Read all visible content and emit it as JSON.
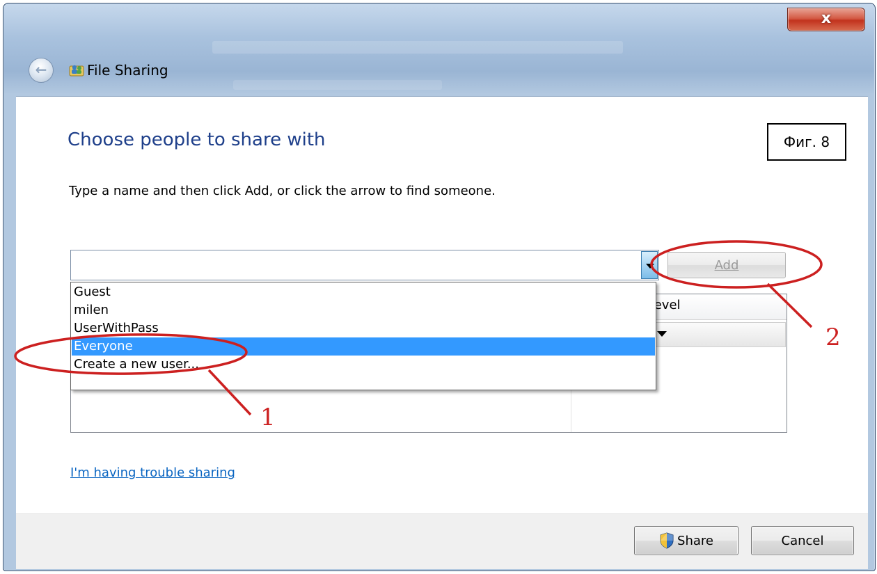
{
  "window": {
    "title": "File Sharing",
    "close_symbol": "x",
    "back_symbol": "←"
  },
  "main": {
    "heading": "Choose people to share with",
    "instruction": "Type a name and then click Add, or click the arrow to find someone.",
    "figure_label": "Фиг. 8",
    "name_input": {
      "value": "",
      "placeholder": ""
    },
    "add_button": "Add",
    "dropdown_items": [
      {
        "label": "Guest",
        "selected": false
      },
      {
        "label": "milen",
        "selected": false
      },
      {
        "label": "UserWithPass",
        "selected": false
      },
      {
        "label": "Everyone",
        "selected": true
      },
      {
        "label": "Create a new user...",
        "selected": false
      }
    ],
    "list_header_level": "Level",
    "level_fragment": "e",
    "trouble_link": "I'm having trouble sharing"
  },
  "footer": {
    "share_button": "Share",
    "cancel_button": "Cancel"
  },
  "annotations": {
    "color": "#cc2020",
    "label_1": "1",
    "label_2": "2"
  },
  "icons": [
    "close-icon",
    "back-arrow-icon",
    "sharing-app-icon",
    "dropdown-arrow-icon",
    "shield-icon"
  ]
}
